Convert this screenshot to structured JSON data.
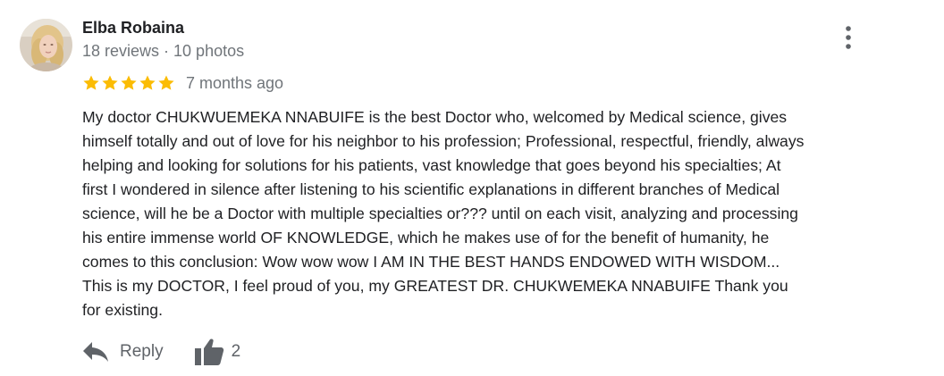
{
  "review": {
    "author_name": "Elba Robaina",
    "author_meta": "18 reviews · 10 photos",
    "rating": 5,
    "rating_max": 5,
    "date": "7 months ago",
    "text": "My doctor CHUKWUEMEKA NNABUIFE is the best Doctor who, welcomed by Medical science, gives\nhimself totally and out of love for his neighbor to his profession;  Professional, respectful, friendly, always\nhelping and looking for solutions for his patients, vast knowledge that goes beyond his specialties;  At\nfirst I wondered in silence after listening to his scientific explanations in different branches of Medical\nscience, will he be a Doctor with multiple specialties or???  until on each visit, analyzing and processing\nhis entire immense world OF KNOWLEDGE, which he makes use of for the benefit of humanity, he\ncomes to this conclusion: Wow wow wow I AM IN THE BEST HANDS ENDOWED WITH WISDOM...\nThis is my DOCTOR, I feel proud of you, my GREATEST DR.  CHUKWEMEKA NNABUIFE Thank you\nfor existing."
  },
  "actions": {
    "reply_label": "Reply",
    "like_count": "2"
  },
  "icons": {
    "more": "more-vertical-icon",
    "star": "star-icon",
    "reply": "reply-icon",
    "like": "thumbs-up-icon"
  },
  "colors": {
    "star": "#fbbc04",
    "icon": "#5f6368",
    "text": "#202124",
    "secondary_text": "#70757a"
  }
}
